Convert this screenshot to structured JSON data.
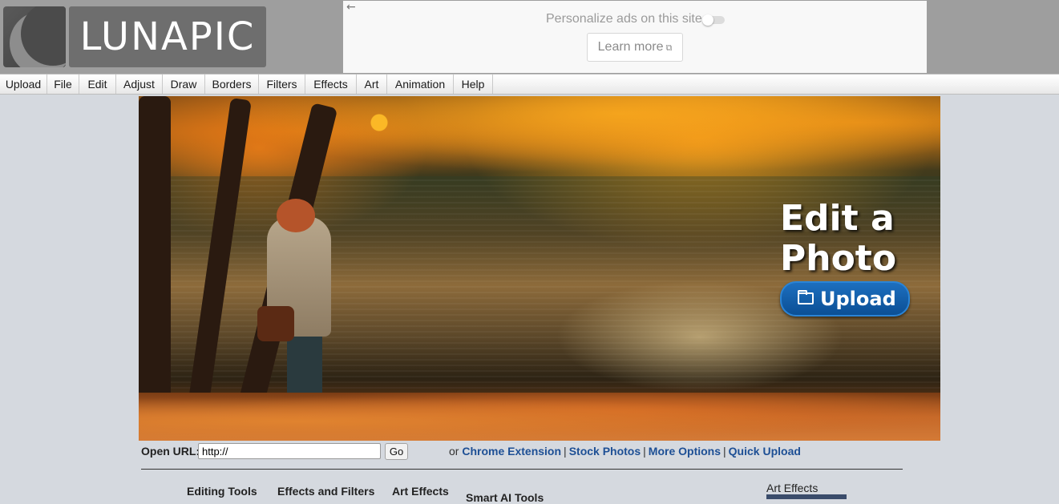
{
  "app": {
    "logo_text": "LUNAPIC"
  },
  "ad": {
    "back_arrow": "←",
    "personalize_text": "Personalize ads on this site",
    "learn_more_label": "Learn more",
    "external_icon": "⧉"
  },
  "menu": {
    "items": [
      "Upload",
      "File",
      "Edit",
      "Adjust",
      "Draw",
      "Borders",
      "Filters",
      "Effects",
      "Art",
      "Animation",
      "Help"
    ]
  },
  "hero": {
    "title": "Edit a Photo",
    "upload_label": "Upload",
    "upload_icon": "folder-icon"
  },
  "url": {
    "label": "Open URL:",
    "value": "http://",
    "go_label": "Go"
  },
  "links": {
    "prefix": "or",
    "items": [
      "Chrome Extension",
      "Stock Photos",
      "More Options",
      "Quick Upload"
    ],
    "separator": "|"
  },
  "tools": {
    "tabs": [
      "Editing Tools",
      "Effects and Filters",
      "Art Effects",
      "Smart AI Tools"
    ]
  },
  "sidebar": {
    "heading": "Art Effects"
  },
  "colors": {
    "link": "#1d4f95",
    "upload_button": "#0b4f95",
    "page_bg": "#d5d9df"
  }
}
